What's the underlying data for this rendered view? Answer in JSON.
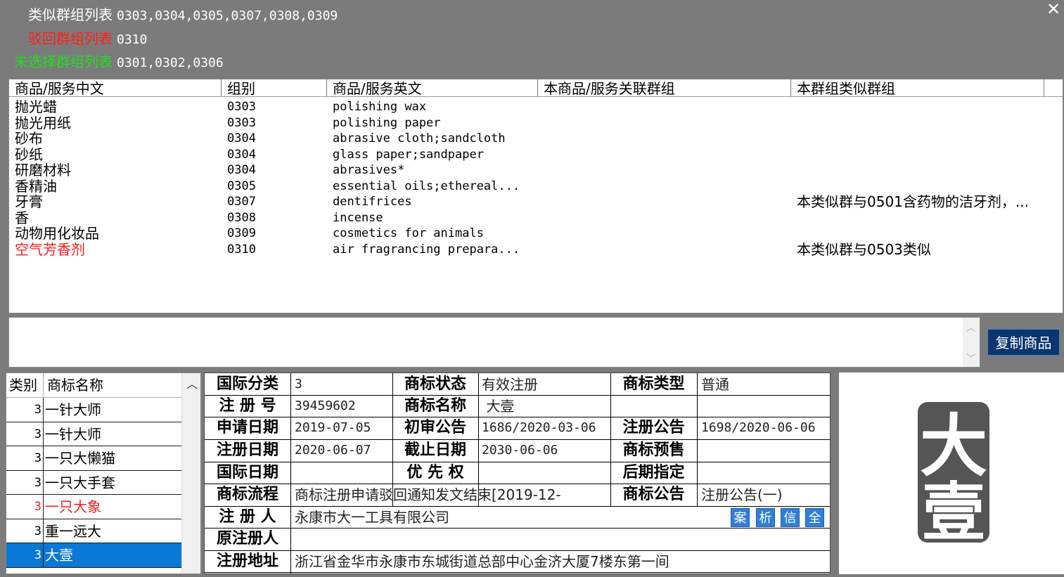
{
  "groups": {
    "similar": {
      "label": "类似群组列表",
      "value": "0303,0304,0305,0307,0308,0309",
      "color": "#ffffff"
    },
    "rejected": {
      "label": "驳回群组列表",
      "value": "0310",
      "color": "#ff2020"
    },
    "unselected": {
      "label": "未选择群组列表",
      "value": "0301,0302,0306",
      "color": "#22dd22"
    }
  },
  "close_label": "✕",
  "goods_table": {
    "headers": [
      "商品/服务中文",
      "组别",
      "商品/服务英文",
      "本商品/服务关联群组",
      "本群组类似群组"
    ],
    "rows": [
      {
        "cn": "抛光蜡",
        "group": "0303",
        "en": "polishing wax",
        "related": "",
        "similar": "",
        "highlight": false
      },
      {
        "cn": "抛光用纸",
        "group": "0303",
        "en": "polishing paper",
        "related": "",
        "similar": "",
        "highlight": false
      },
      {
        "cn": "砂布",
        "group": "0304",
        "en": "abrasive cloth;sandcloth",
        "related": "",
        "similar": "",
        "highlight": false
      },
      {
        "cn": "砂纸",
        "group": "0304",
        "en": "glass paper;sandpaper",
        "related": "",
        "similar": "",
        "highlight": false
      },
      {
        "cn": "研磨材料",
        "group": "0304",
        "en": "abrasives*",
        "related": "",
        "similar": "",
        "highlight": false
      },
      {
        "cn": "香精油",
        "group": "0305",
        "en": "essential oils;ethereal...",
        "related": "",
        "similar": "",
        "highlight": false
      },
      {
        "cn": "牙膏",
        "group": "0307",
        "en": "dentifrices",
        "related": "",
        "similar": "本类似群与0501含药物的洁牙剂，...",
        "highlight": false
      },
      {
        "cn": "香",
        "group": "0308",
        "en": "incense",
        "related": "",
        "similar": "",
        "highlight": false
      },
      {
        "cn": "动物用化妆品",
        "group": "0309",
        "en": "cosmetics for animals",
        "related": "",
        "similar": "",
        "highlight": false
      },
      {
        "cn": "空气芳香剂",
        "group": "0310",
        "en": "air fragrancing prepara...",
        "related": "",
        "similar": "本类似群与0503类似",
        "highlight": true
      }
    ]
  },
  "copy_button": "复制商品",
  "tm_list": {
    "headers": [
      "类别",
      "商标名称"
    ],
    "rows": [
      {
        "cls": "3",
        "name": "一针大师",
        "state": "normal"
      },
      {
        "cls": "3",
        "name": "一针大师",
        "state": "normal"
      },
      {
        "cls": "3",
        "name": "一只大懒猫",
        "state": "normal"
      },
      {
        "cls": "3",
        "name": "一只大手套",
        "state": "normal"
      },
      {
        "cls": "3",
        "name": "一只大象",
        "state": "red"
      },
      {
        "cls": "3",
        "name": "重一远大",
        "state": "normal"
      },
      {
        "cls": "3",
        "name": "大壹",
        "state": "selected"
      }
    ]
  },
  "detail": {
    "intl_class_label": "国际分类",
    "intl_class": "3",
    "status_label": "商标状态",
    "status": "有效注册",
    "type_label": "商标类型",
    "type": "普通",
    "reg_no_label": "注 册 号",
    "reg_no": "39459602",
    "name_label": "商标名称",
    "name": " 大壹",
    "apply_date_label": "申请日期",
    "apply_date": "2019-07-05",
    "prelim_label": "初审公告",
    "prelim": "1686/2020-03-06",
    "reg_notice_label": "注册公告",
    "reg_notice": "1698/2020-06-06",
    "reg_date_label": "注册日期",
    "reg_date": "2020-06-07",
    "expiry_label": "截止日期",
    "expiry": "2030-06-06",
    "presale_label": "商标预售",
    "presale": "",
    "intl_date_label": "国际日期",
    "intl_date": "",
    "priority_label": "优 先 权",
    "priority": "",
    "later_label": "后期指定",
    "later": "",
    "process_label": "商标流程",
    "process": "商标注册申请驳回通知发文结束[2019-12-",
    "bulletin_label": "商标公告",
    "bulletin": "注册公告(一)",
    "registrant_label": "注 册 人",
    "registrant": "永康市大一工具有限公司",
    "orig_reg_label": "原注册人",
    "orig_reg": "",
    "address_label": "注册地址",
    "address": "浙江省金华市永康市东城街道总部中心金济大厦7楼东第一间",
    "mini_buttons": [
      "案",
      "析",
      "信",
      "全"
    ]
  },
  "logo": {
    "text_top": "大",
    "text_bottom": "壹",
    "color": "#555555"
  }
}
